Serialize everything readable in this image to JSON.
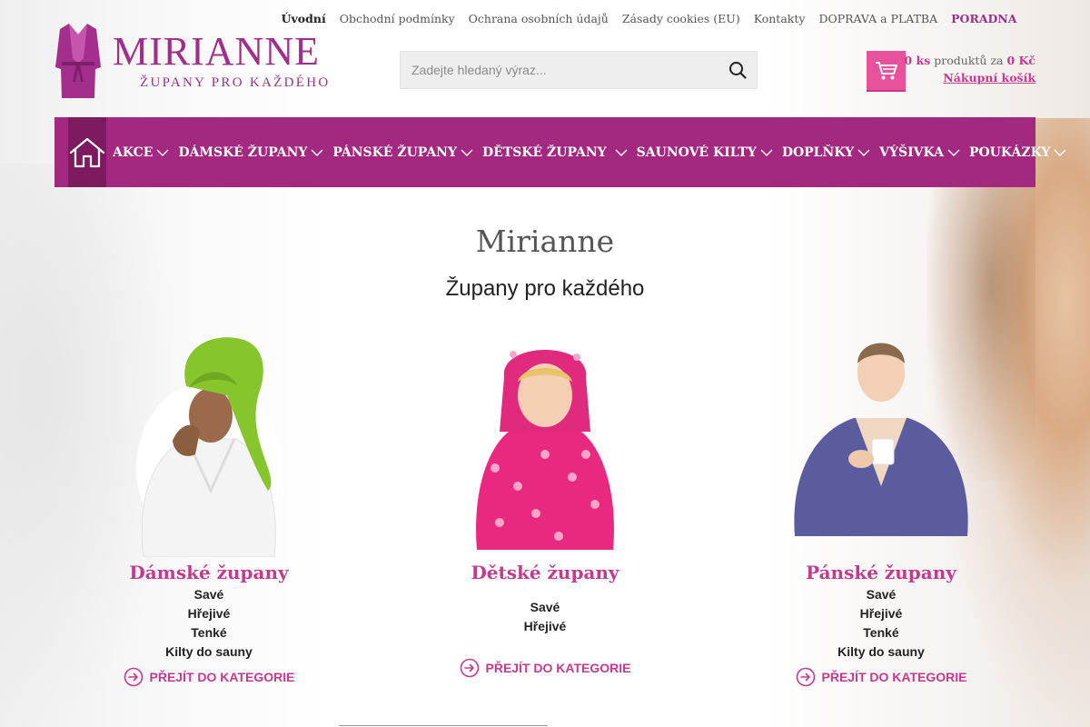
{
  "brand": {
    "name": "MIRIANNE",
    "tagline": "ŽUPANY PRO KAŽDÉHO",
    "color": "#9e2f8a"
  },
  "top_menu": [
    {
      "label": "Úvodní",
      "active": true
    },
    {
      "label": "Obchodní podmínky"
    },
    {
      "label": "Ochrana osobních údajů"
    },
    {
      "label": "Zásady cookies (EU)"
    },
    {
      "label": "Kontakty"
    },
    {
      "label": "DOPRAVA a PLATBA"
    },
    {
      "label": "PORADNA",
      "highlight": true
    }
  ],
  "search": {
    "placeholder": "Zadejte hledaný výraz...",
    "icon": "search-icon"
  },
  "cart": {
    "count": "0 ks",
    "text_mid": "produktů za",
    "price": "0 Kč",
    "link_label": "Nákupní košík",
    "icon": "cart-icon",
    "accent": "#e8519c"
  },
  "nav": {
    "home_icon": "home-icon",
    "items": [
      {
        "label": "AKCE"
      },
      {
        "label": "DÁMSKÉ ŽUPANY"
      },
      {
        "label": "PÁNSKÉ ŽUPANY"
      },
      {
        "label": "DĚTSKÉ ŽUPANY"
      },
      {
        "label": "SAUNOVÉ KILTY"
      },
      {
        "label": "DOPLŇKY"
      },
      {
        "label": "VÝŠIVKA"
      },
      {
        "label": "POUKÁZKY"
      }
    ],
    "background": "#a3287f"
  },
  "hero": {
    "title": "Mirianne",
    "subtitle": "Župany pro každého"
  },
  "categories": [
    {
      "title": "Dámské župany",
      "items": [
        "Savé",
        "Hřejivé",
        "Tenké",
        "Kilty do sauny"
      ],
      "link": "PŘEJÍT DO KATEGORIE"
    },
    {
      "title": "Dětské župany",
      "items": [
        "Savé",
        "Hřejivé"
      ],
      "link": "PŘEJÍT DO KATEGORIE"
    },
    {
      "title": "Pánské župany",
      "items": [
        "Savé",
        "Hřejivé",
        "Tenké",
        "Kilty do sauny"
      ],
      "link": "PŘEJÍT DO KATEGORIE"
    }
  ]
}
